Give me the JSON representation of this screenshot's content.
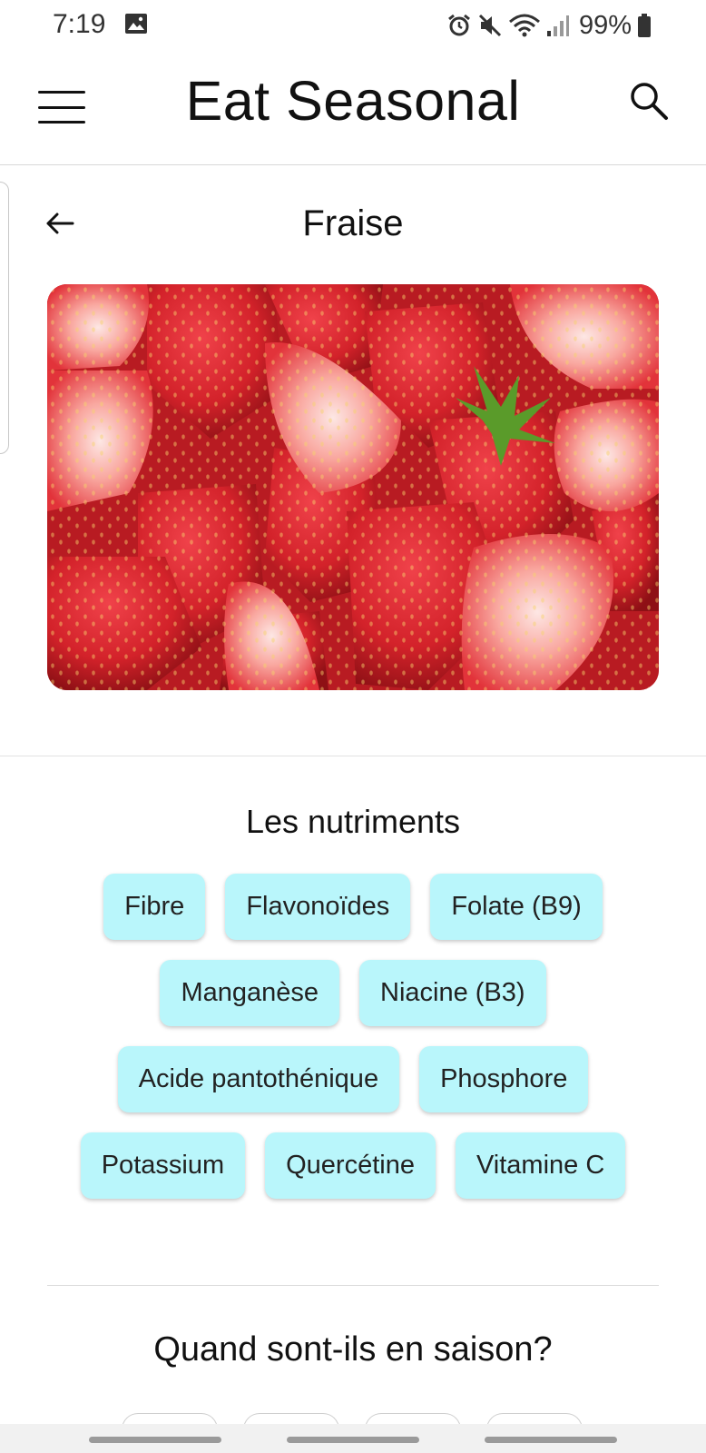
{
  "status_bar": {
    "time": "7:19",
    "battery_percent": "99%",
    "icons": [
      "gallery-icon",
      "alarm-icon",
      "mute-icon",
      "wifi-icon",
      "signal-icon",
      "battery-icon"
    ]
  },
  "app_bar": {
    "title": "Eat Seasonal",
    "icons": [
      "menu-icon",
      "search-icon"
    ]
  },
  "detail": {
    "title": "Fraise",
    "back_icon": "arrow-left-icon",
    "image_subject": "strawberries"
  },
  "nutrients": {
    "title": "Les nutriments",
    "items": [
      "Fibre",
      "Flavonoïdes",
      "Folate (B9)",
      "Manganèse",
      "Niacine (B3)",
      "Acide pantothénique",
      "Phosphore",
      "Potassium",
      "Quercétine",
      "Vitamine C"
    ]
  },
  "season": {
    "title": "Quand sont-ils en saison?"
  },
  "colors": {
    "chip_background": "#b9f6fb",
    "text": "#111111",
    "divider": "#e2e2e2",
    "strawberry_red": "#d3222a"
  }
}
